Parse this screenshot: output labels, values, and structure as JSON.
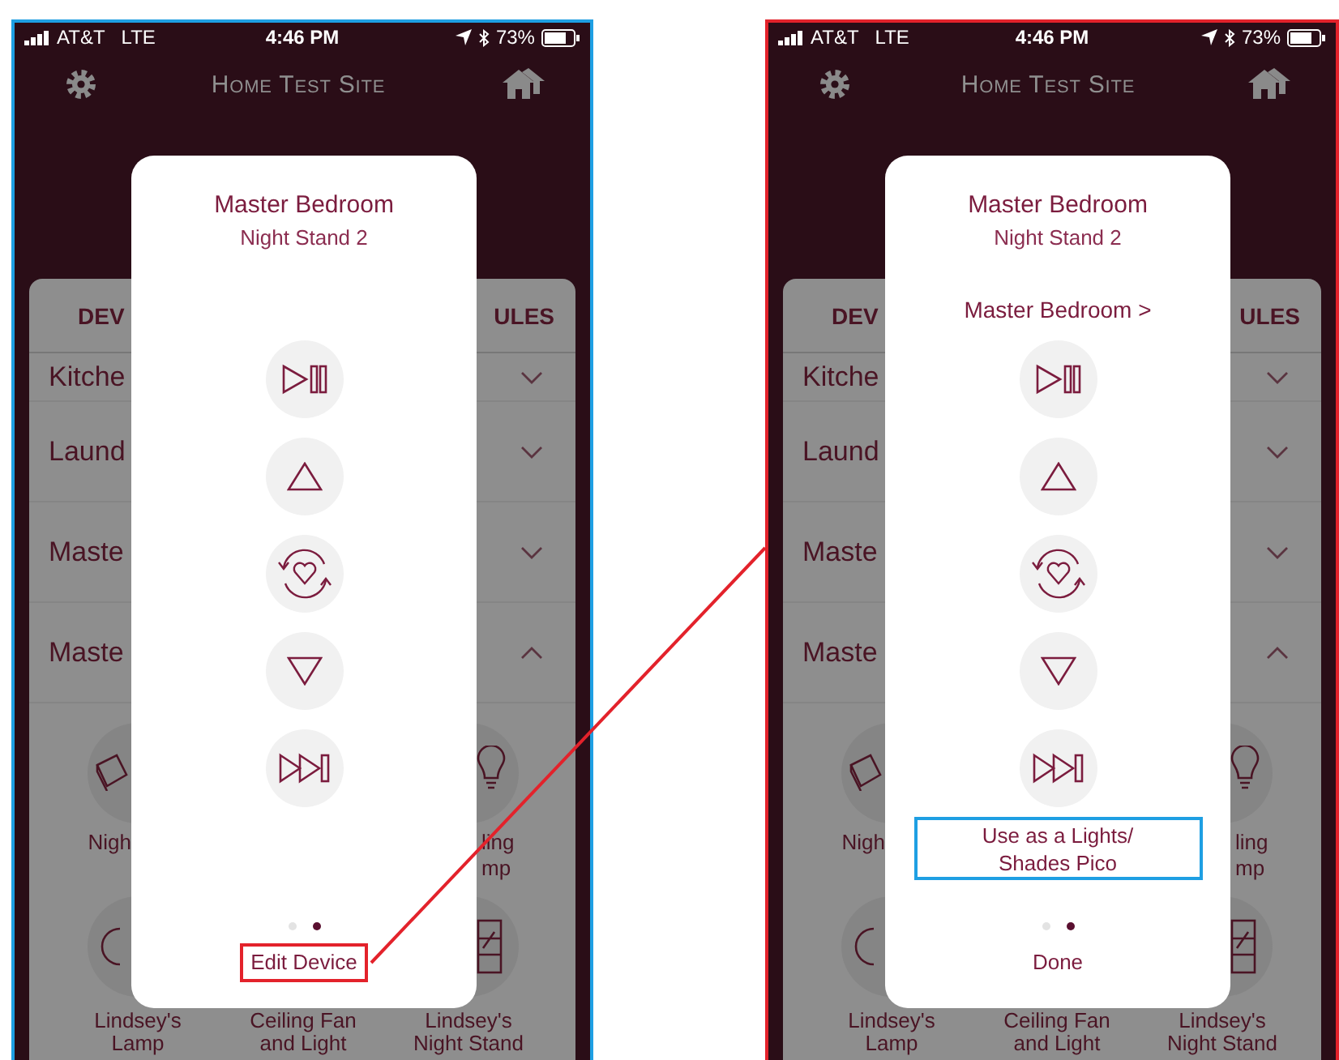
{
  "phones": [
    {
      "color": "#1e9fe3",
      "status": {
        "carrier": "AT&T",
        "network": "LTE",
        "time": "4:46 PM",
        "battery": "73%"
      },
      "header": {
        "title": "Home Test Site"
      },
      "tabs": [
        "DEV",
        "ULES"
      ],
      "rooms": [
        {
          "name": "Kitche",
          "expanded": false
        },
        {
          "name": "Laund",
          "expanded": false
        },
        {
          "name": "Maste",
          "expanded": false
        },
        {
          "name": "Maste",
          "expanded": true
        }
      ],
      "device_rows": [
        [
          {
            "kind": "book",
            "lines": [
              "Nigh"
            ]
          },
          {
            "kind": "bulb",
            "lines": [
              "ling",
              "mp"
            ]
          }
        ],
        [
          {
            "kind": "lamp",
            "lines": [
              "Lindsey's",
              "Lamp"
            ]
          },
          {
            "kind": "fan",
            "lines": [
              "Ceiling Fan",
              "and Light"
            ]
          },
          {
            "kind": "shade",
            "lines": [
              "Lindsey's",
              "Night Stand"
            ]
          }
        ]
      ],
      "modal": {
        "title": "Master Bedroom",
        "subtitle": "Night Stand 2",
        "buttons": [
          {
            "kind": "play_pause"
          },
          {
            "kind": "raise"
          },
          {
            "kind": "favorite"
          },
          {
            "kind": "lower"
          },
          {
            "kind": "next"
          }
        ],
        "page_dots": [
          {
            "selected": false
          },
          {
            "selected": true
          }
        ],
        "footer": {
          "label": "Edit Device",
          "color": "#e3222b"
        }
      }
    },
    {
      "color": "#e3222b",
      "status": {
        "carrier": "AT&T",
        "network": "LTE",
        "time": "4:46 PM",
        "battery": "73%"
      },
      "header": {
        "title": "Home Test Site"
      },
      "tabs": [
        "DEV",
        "ULES"
      ],
      "rooms": [
        {
          "name": "Kitche",
          "expanded": false
        },
        {
          "name": "Laund",
          "expanded": false
        },
        {
          "name": "Maste",
          "expanded": false
        },
        {
          "name": "Maste",
          "expanded": true
        }
      ],
      "device_rows": [
        [
          {
            "kind": "book",
            "lines": [
              "Nigh"
            ]
          },
          {
            "kind": "bulb",
            "lines": [
              "ling",
              "mp"
            ]
          }
        ],
        [
          {
            "kind": "lamp",
            "lines": [
              "Lindsey's",
              "Lamp"
            ]
          },
          {
            "kind": "fan",
            "lines": [
              "Ceiling Fan",
              "and Light"
            ]
          },
          {
            "kind": "shade",
            "lines": [
              "Lindsey's",
              "Night Stand"
            ]
          }
        ]
      ],
      "modal": {
        "title": "Master Bedroom",
        "subtitle": "Night Stand 2",
        "room_link": "Master Bedroom >",
        "buttons": [
          {
            "kind": "play_pause"
          },
          {
            "kind": "raise"
          },
          {
            "kind": "favorite"
          },
          {
            "kind": "lower"
          },
          {
            "kind": "next"
          }
        ],
        "action": {
          "lines": [
            "Use as a Lights/",
            "Shades Pico"
          ],
          "color": "#1e9fe3"
        },
        "page_dots": [
          {
            "selected": false
          },
          {
            "selected": true
          }
        ],
        "footer": {
          "label": "Done"
        }
      }
    }
  ],
  "connector": {
    "color": "#e3222b"
  }
}
